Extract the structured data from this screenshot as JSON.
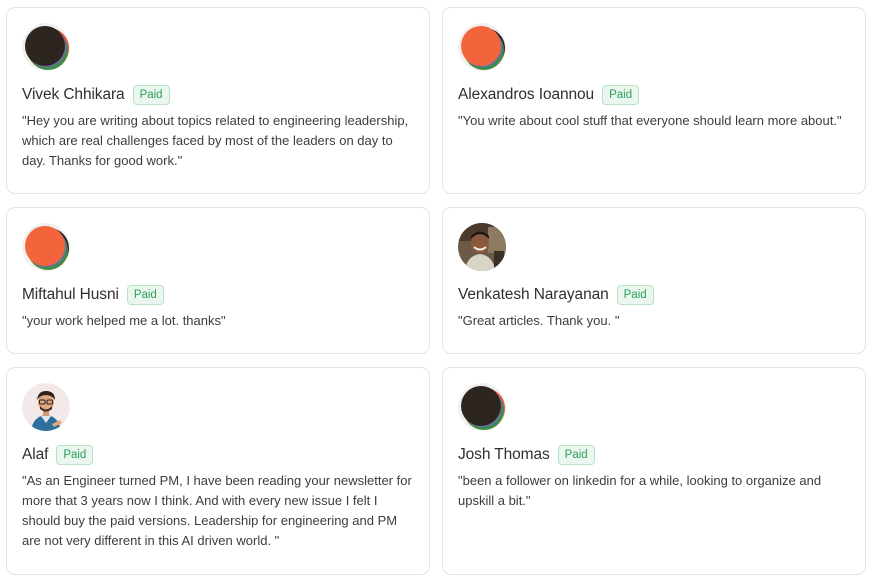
{
  "badge_label": "Paid",
  "testimonials": [
    {
      "name": "Vivek Chhikara",
      "quote": "\"Hey you are writing about topics related to engineering leadership, which are real challenges faced by most of the leaders on day to day. Thanks for good work.\"",
      "avatar": "dark-multicolor-disc"
    },
    {
      "name": "Alexandros Ioannou",
      "quote": "\"You write about cool stuff that everyone should learn more about.\"",
      "avatar": "orange-multicolor-disc"
    },
    {
      "name": "Miftahul Husni",
      "quote": "\"your work helped me a lot. thanks\"",
      "avatar": "orange-multicolor-disc"
    },
    {
      "name": "Venkatesh Narayanan",
      "quote": "\"Great articles. Thank you. \"",
      "avatar": "profile-photo"
    },
    {
      "name": "Alaf",
      "quote": "\"As an Engineer turned PM, I have been reading your newsletter for more that 3 years now I think. And with every new issue I felt I should buy the paid versions. Leadership for engineering and PM are not very different in this AI driven world. \"",
      "avatar": "cartoon-person-avatar"
    },
    {
      "name": "Josh Thomas",
      "quote": "\"been a follower on linkedin for a while, looking to organize and upskill a bit.\"",
      "avatar": "dark-multicolor-disc"
    }
  ],
  "colors": {
    "badge_text": "#2f9e5a",
    "badge_bg": "#eaf7ee",
    "card_border": "#e4e4e4"
  }
}
